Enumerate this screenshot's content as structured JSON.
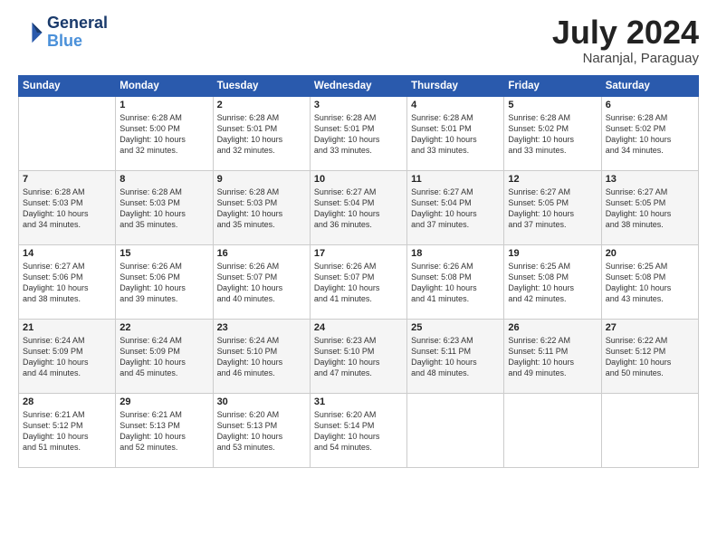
{
  "header": {
    "logo_line1": "General",
    "logo_line2": "Blue",
    "month": "July 2024",
    "location": "Naranjal, Paraguay"
  },
  "days_of_week": [
    "Sunday",
    "Monday",
    "Tuesday",
    "Wednesday",
    "Thursday",
    "Friday",
    "Saturday"
  ],
  "weeks": [
    [
      {
        "day": "",
        "info": ""
      },
      {
        "day": "1",
        "info": "Sunrise: 6:28 AM\nSunset: 5:00 PM\nDaylight: 10 hours\nand 32 minutes."
      },
      {
        "day": "2",
        "info": "Sunrise: 6:28 AM\nSunset: 5:01 PM\nDaylight: 10 hours\nand 32 minutes."
      },
      {
        "day": "3",
        "info": "Sunrise: 6:28 AM\nSunset: 5:01 PM\nDaylight: 10 hours\nand 33 minutes."
      },
      {
        "day": "4",
        "info": "Sunrise: 6:28 AM\nSunset: 5:01 PM\nDaylight: 10 hours\nand 33 minutes."
      },
      {
        "day": "5",
        "info": "Sunrise: 6:28 AM\nSunset: 5:02 PM\nDaylight: 10 hours\nand 33 minutes."
      },
      {
        "day": "6",
        "info": "Sunrise: 6:28 AM\nSunset: 5:02 PM\nDaylight: 10 hours\nand 34 minutes."
      }
    ],
    [
      {
        "day": "7",
        "info": "Sunrise: 6:28 AM\nSunset: 5:03 PM\nDaylight: 10 hours\nand 34 minutes."
      },
      {
        "day": "8",
        "info": "Sunrise: 6:28 AM\nSunset: 5:03 PM\nDaylight: 10 hours\nand 35 minutes."
      },
      {
        "day": "9",
        "info": "Sunrise: 6:28 AM\nSunset: 5:03 PM\nDaylight: 10 hours\nand 35 minutes."
      },
      {
        "day": "10",
        "info": "Sunrise: 6:27 AM\nSunset: 5:04 PM\nDaylight: 10 hours\nand 36 minutes."
      },
      {
        "day": "11",
        "info": "Sunrise: 6:27 AM\nSunset: 5:04 PM\nDaylight: 10 hours\nand 37 minutes."
      },
      {
        "day": "12",
        "info": "Sunrise: 6:27 AM\nSunset: 5:05 PM\nDaylight: 10 hours\nand 37 minutes."
      },
      {
        "day": "13",
        "info": "Sunrise: 6:27 AM\nSunset: 5:05 PM\nDaylight: 10 hours\nand 38 minutes."
      }
    ],
    [
      {
        "day": "14",
        "info": "Sunrise: 6:27 AM\nSunset: 5:06 PM\nDaylight: 10 hours\nand 38 minutes."
      },
      {
        "day": "15",
        "info": "Sunrise: 6:26 AM\nSunset: 5:06 PM\nDaylight: 10 hours\nand 39 minutes."
      },
      {
        "day": "16",
        "info": "Sunrise: 6:26 AM\nSunset: 5:07 PM\nDaylight: 10 hours\nand 40 minutes."
      },
      {
        "day": "17",
        "info": "Sunrise: 6:26 AM\nSunset: 5:07 PM\nDaylight: 10 hours\nand 41 minutes."
      },
      {
        "day": "18",
        "info": "Sunrise: 6:26 AM\nSunset: 5:08 PM\nDaylight: 10 hours\nand 41 minutes."
      },
      {
        "day": "19",
        "info": "Sunrise: 6:25 AM\nSunset: 5:08 PM\nDaylight: 10 hours\nand 42 minutes."
      },
      {
        "day": "20",
        "info": "Sunrise: 6:25 AM\nSunset: 5:08 PM\nDaylight: 10 hours\nand 43 minutes."
      }
    ],
    [
      {
        "day": "21",
        "info": "Sunrise: 6:24 AM\nSunset: 5:09 PM\nDaylight: 10 hours\nand 44 minutes."
      },
      {
        "day": "22",
        "info": "Sunrise: 6:24 AM\nSunset: 5:09 PM\nDaylight: 10 hours\nand 45 minutes."
      },
      {
        "day": "23",
        "info": "Sunrise: 6:24 AM\nSunset: 5:10 PM\nDaylight: 10 hours\nand 46 minutes."
      },
      {
        "day": "24",
        "info": "Sunrise: 6:23 AM\nSunset: 5:10 PM\nDaylight: 10 hours\nand 47 minutes."
      },
      {
        "day": "25",
        "info": "Sunrise: 6:23 AM\nSunset: 5:11 PM\nDaylight: 10 hours\nand 48 minutes."
      },
      {
        "day": "26",
        "info": "Sunrise: 6:22 AM\nSunset: 5:11 PM\nDaylight: 10 hours\nand 49 minutes."
      },
      {
        "day": "27",
        "info": "Sunrise: 6:22 AM\nSunset: 5:12 PM\nDaylight: 10 hours\nand 50 minutes."
      }
    ],
    [
      {
        "day": "28",
        "info": "Sunrise: 6:21 AM\nSunset: 5:12 PM\nDaylight: 10 hours\nand 51 minutes."
      },
      {
        "day": "29",
        "info": "Sunrise: 6:21 AM\nSunset: 5:13 PM\nDaylight: 10 hours\nand 52 minutes."
      },
      {
        "day": "30",
        "info": "Sunrise: 6:20 AM\nSunset: 5:13 PM\nDaylight: 10 hours\nand 53 minutes."
      },
      {
        "day": "31",
        "info": "Sunrise: 6:20 AM\nSunset: 5:14 PM\nDaylight: 10 hours\nand 54 minutes."
      },
      {
        "day": "",
        "info": ""
      },
      {
        "day": "",
        "info": ""
      },
      {
        "day": "",
        "info": ""
      }
    ]
  ]
}
